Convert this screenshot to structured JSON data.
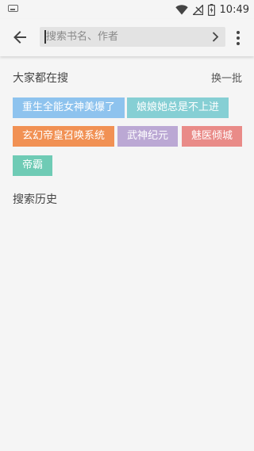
{
  "status_bar": {
    "time": "10:49",
    "icons": [
      "keyboard-icon",
      "wifi-icon",
      "no-signal-icon",
      "battery-charging-icon"
    ]
  },
  "toolbar": {
    "search_placeholder": "搜索书名、作者",
    "icons": [
      "back-arrow-icon",
      "chevron-right-icon",
      "more-vert-icon"
    ]
  },
  "hot_search": {
    "title": "大家都在搜",
    "refresh_label": "换一批",
    "tags": [
      {
        "label": "重生全能女神美爆了",
        "color": "#8ec3ee"
      },
      {
        "label": "娘娘她总是不上进",
        "color": "#86cfd4"
      },
      {
        "label": "玄幻帝皇召唤系统",
        "color": "#f19154"
      },
      {
        "label": "武神纪元",
        "color": "#bba8d4"
      },
      {
        "label": "魅医倾城",
        "color": "#e98b88"
      },
      {
        "label": "帝霸",
        "color": "#6fcbb5"
      }
    ]
  },
  "history": {
    "title": "搜索历史"
  }
}
